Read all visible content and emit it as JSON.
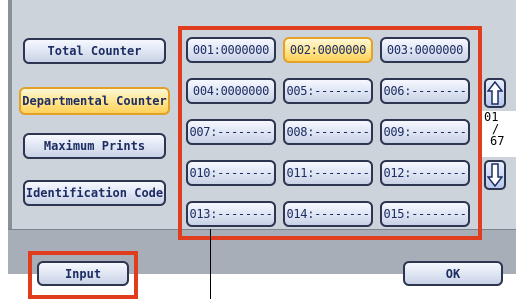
{
  "left_buttons": [
    {
      "label": "Total Counter",
      "selected": false
    },
    {
      "label": "Departmental Counter",
      "selected": true
    },
    {
      "label": "Maximum Prints",
      "selected": false
    },
    {
      "label": "Identification Code",
      "selected": false
    }
  ],
  "counters": [
    {
      "label": "001:0000000",
      "selected": false
    },
    {
      "label": "002:0000000",
      "selected": true
    },
    {
      "label": "003:0000000",
      "selected": false
    },
    {
      "label": "004:0000000",
      "selected": false
    },
    {
      "label": "005:--------",
      "selected": false
    },
    {
      "label": "006:--------",
      "selected": false
    },
    {
      "label": "007:--------",
      "selected": false
    },
    {
      "label": "008:--------",
      "selected": false
    },
    {
      "label": "009:--------",
      "selected": false
    },
    {
      "label": "010:--------",
      "selected": false
    },
    {
      "label": "011:--------",
      "selected": false
    },
    {
      "label": "012:--------",
      "selected": false
    },
    {
      "label": "013:--------",
      "selected": false
    },
    {
      "label": "014:--------",
      "selected": false
    },
    {
      "label": "015:--------",
      "selected": false
    }
  ],
  "pagination": {
    "current": "01",
    "separator": "/",
    "total": "67"
  },
  "bottom": {
    "input_label": "Input",
    "ok_label": "OK"
  },
  "colors": {
    "highlight_outline": "#e03c1e",
    "selected_fill": "#ffe48a",
    "button_text": "#1d2d63"
  },
  "icons": {
    "scroll_up": "arrow-up-icon",
    "scroll_down": "arrow-down-icon"
  }
}
